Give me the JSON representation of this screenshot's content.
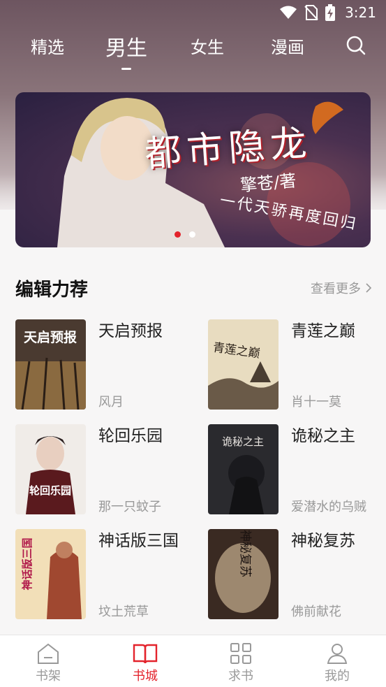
{
  "status_bar": {
    "time": "3:21"
  },
  "top_tabs": [
    {
      "label": "精选"
    },
    {
      "label": "男生"
    },
    {
      "label": "女生"
    },
    {
      "label": "漫画"
    }
  ],
  "banner": {
    "title": "都市隐龙",
    "author": "擎苍/著",
    "slogan": "一代天骄再度回归",
    "dots": 2,
    "active_dot": 1
  },
  "section": {
    "title": "编辑力荐",
    "see_more": "查看更多"
  },
  "books": [
    {
      "title": "天启预报",
      "author": "风月",
      "cover_text": "天启预报"
    },
    {
      "title": "青莲之巅",
      "author": "肖十一莫",
      "cover_text": "青莲之巅"
    },
    {
      "title": "轮回乐园",
      "author": "那一只蚊子",
      "cover_text": "轮回乐园"
    },
    {
      "title": "诡秘之主",
      "author": "爱潜水的乌贼",
      "cover_text": "诡秘之主"
    },
    {
      "title": "神话版三国",
      "author": "坟土荒草",
      "cover_text": "神话版三国"
    },
    {
      "title": "神秘复苏",
      "author": "佛前献花",
      "cover_text": "神秘复苏"
    }
  ],
  "bottom_nav": [
    {
      "label": "书架",
      "icon": "bookshelf-icon"
    },
    {
      "label": "书城",
      "icon": "open-book-icon",
      "active": true
    },
    {
      "label": "求书",
      "icon": "grid-icon"
    },
    {
      "label": "我的",
      "icon": "person-icon"
    }
  ],
  "colors": {
    "accent": "#e3232c",
    "muted": "#999999"
  }
}
